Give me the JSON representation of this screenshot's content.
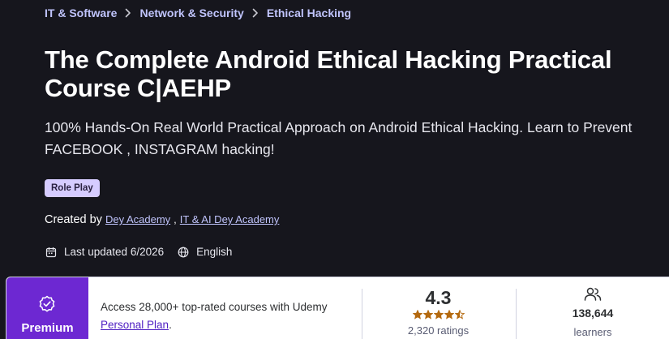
{
  "breadcrumb": {
    "items": [
      "IT & Software",
      "Network & Security",
      "Ethical Hacking"
    ]
  },
  "course": {
    "title": "The Complete Android Ethical Hacking Practical Course C|AEHP",
    "subtitle": "100% Hands-On Real World Practical Approach on Android Ethical Hacking. Learn to Prevent FACEBOOK , INSTAGRAM hacking!",
    "badge": "Role Play",
    "created_by_label": "Created by",
    "instructors": [
      "Dey Academy",
      "IT & AI Dey Academy"
    ],
    "instructor_separator": ",",
    "last_updated": "Last updated 6/2026",
    "language": "English"
  },
  "premium_card": {
    "premium_label": "Premium",
    "access_text": "Access 28,000+ top-rated courses with Udemy",
    "plan_link": "Personal Plan",
    "plan_suffix": ".",
    "rating_value": "4.3",
    "rating_stars": 4.3,
    "ratings_count": "2,320 ratings",
    "learners_count": "138,644",
    "learners_label": "learners"
  },
  "colors": {
    "background": "#16161d",
    "link": "#c0c4fc",
    "badge_bg": "#d6ccff",
    "premium_bg": "#6d28d2",
    "star": "#b4690e"
  },
  "icons": {
    "breadcrumb_separator": "chevron-right-icon",
    "last_updated": "calendar-icon",
    "language": "globe-icon",
    "premium": "badge-check-icon",
    "learners": "users-icon"
  }
}
